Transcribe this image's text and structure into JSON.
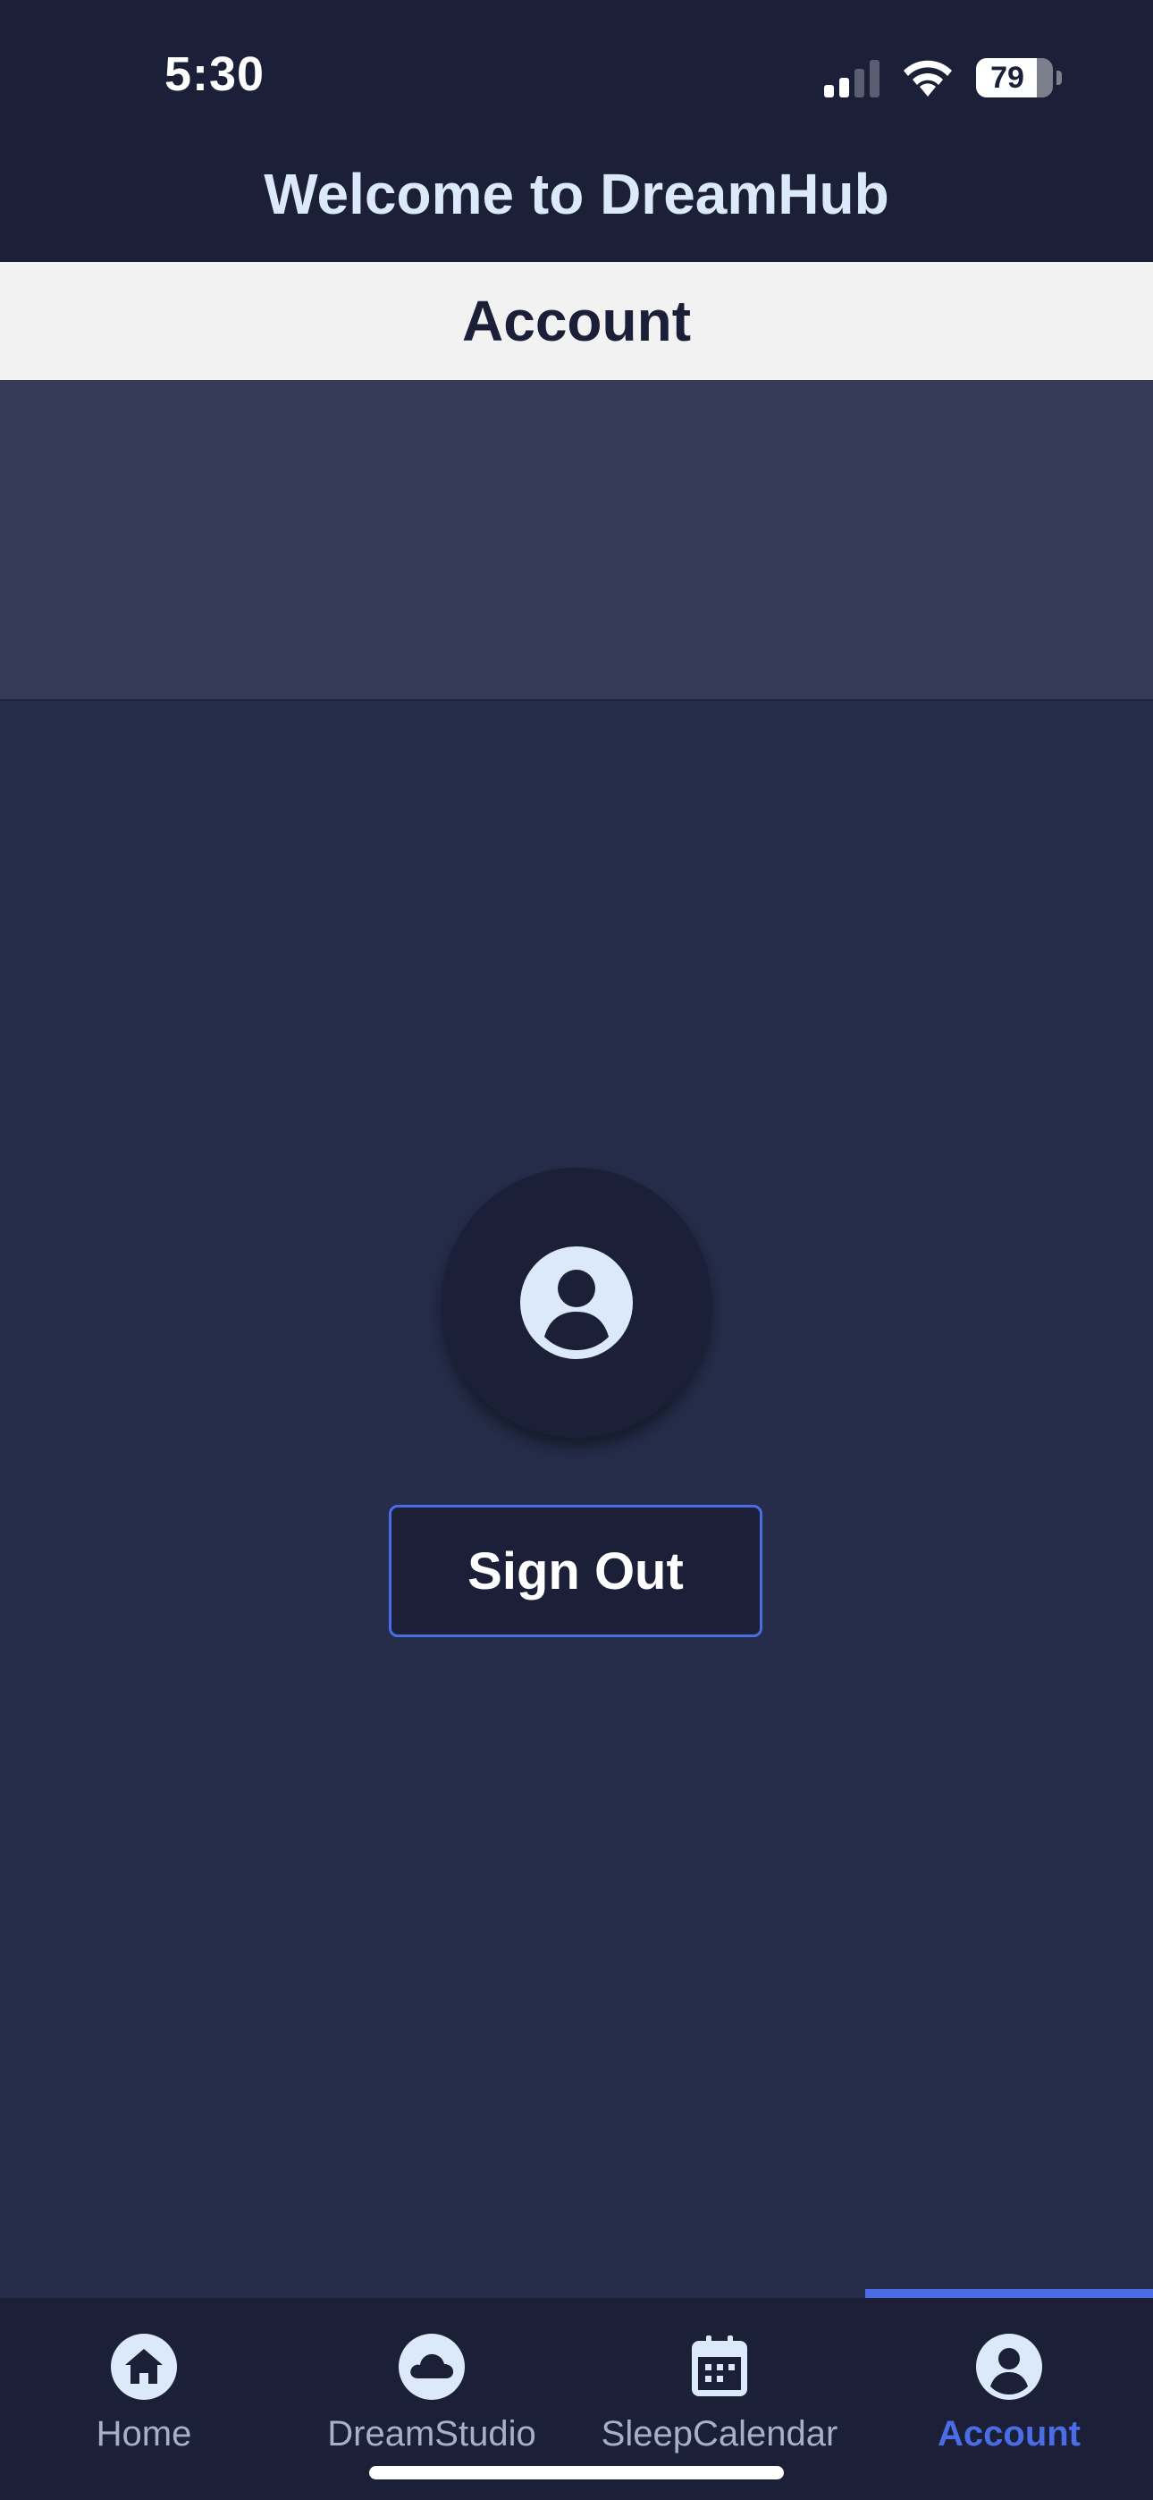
{
  "status_bar": {
    "time": "5:30",
    "battery_level": "79"
  },
  "header": {
    "app_title": "Welcome to DreamHub",
    "page_title": "Account"
  },
  "account": {
    "sign_out_label": "Sign Out",
    "avatar_icon": "person-circle-icon"
  },
  "bottom_nav": {
    "items": [
      {
        "label": "Home",
        "icon": "home-icon"
      },
      {
        "label": "DreamStudio",
        "icon": "cloud-icon"
      },
      {
        "label": "SleepCalendar",
        "icon": "calendar-icon"
      },
      {
        "label": "Account",
        "icon": "person-circle-icon"
      }
    ],
    "active_index": 3
  },
  "colors": {
    "navy": "#1b1f38",
    "background": "#252d4a",
    "banner": "#353b56",
    "accent": "#4a6de5",
    "icon_light": "#dce9fb"
  }
}
